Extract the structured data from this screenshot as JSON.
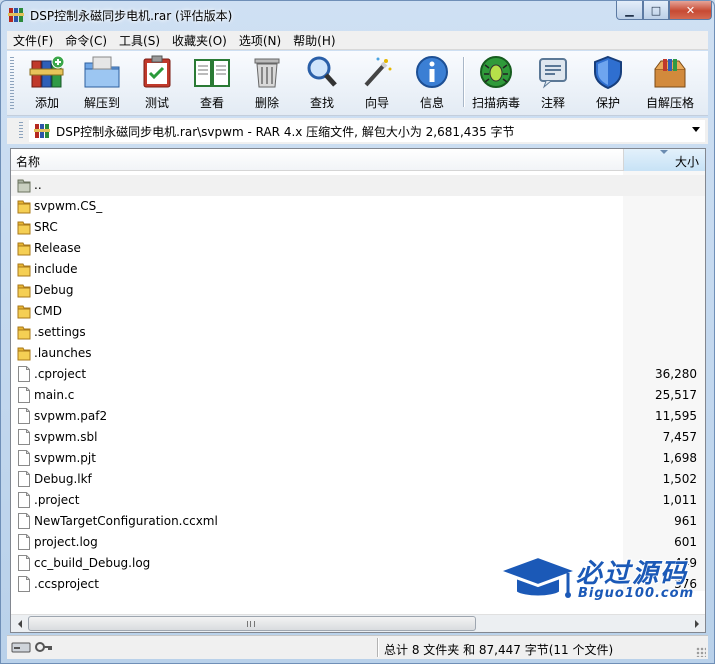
{
  "window": {
    "title": "DSP控制永磁同步电机.rar (评估版本)",
    "minimize_glyph": "▁",
    "maximize_glyph": "□",
    "close_glyph": "✕"
  },
  "menu": [
    "文件(F)",
    "命令(C)",
    "工具(S)",
    "收藏夹(O)",
    "选项(N)",
    "帮助(H)"
  ],
  "toolbar": {
    "add": "添加",
    "extract_to": "解压到",
    "test": "测试",
    "view": "查看",
    "delete": "删除",
    "find": "查找",
    "wizard": "向导",
    "info": "信息",
    "virus_scan": "扫描病毒",
    "comment": "注释",
    "protect": "保护",
    "sfx": "自解压格"
  },
  "address": {
    "text": "DSP控制永磁同步电机.rar\\svpwm - RAR 4.x 压缩文件, 解包大小为 2,681,435 字节"
  },
  "columns": {
    "name": "名称",
    "size": "大小"
  },
  "files": [
    {
      "name": "..",
      "size": "",
      "type": "parent"
    },
    {
      "name": "svpwm.CS_",
      "size": "",
      "type": "folder"
    },
    {
      "name": "SRC",
      "size": "",
      "type": "folder"
    },
    {
      "name": "Release",
      "size": "",
      "type": "folder"
    },
    {
      "name": "include",
      "size": "",
      "type": "folder"
    },
    {
      "name": "Debug",
      "size": "",
      "type": "folder"
    },
    {
      "name": "CMD",
      "size": "",
      "type": "folder"
    },
    {
      "name": ".settings",
      "size": "",
      "type": "folder"
    },
    {
      "name": ".launches",
      "size": "",
      "type": "folder"
    },
    {
      "name": ".cproject",
      "size": "36,280",
      "type": "file"
    },
    {
      "name": "main.c",
      "size": "25,517",
      "type": "file"
    },
    {
      "name": "svpwm.paf2",
      "size": "11,595",
      "type": "file"
    },
    {
      "name": "svpwm.sbl",
      "size": "7,457",
      "type": "file"
    },
    {
      "name": "svpwm.pjt",
      "size": "1,698",
      "type": "file"
    },
    {
      "name": "Debug.lkf",
      "size": "1,502",
      "type": "file"
    },
    {
      "name": ".project",
      "size": "1,011",
      "type": "file"
    },
    {
      "name": "NewTargetConfiguration.ccxml",
      "size": "961",
      "type": "file"
    },
    {
      "name": "project.log",
      "size": "601",
      "type": "file"
    },
    {
      "name": "cc_build_Debug.log",
      "size": "449",
      "type": "file"
    },
    {
      "name": ".ccsproject",
      "size": "376",
      "type": "file"
    }
  ],
  "status": {
    "text": "总计 8 文件夹 和 87,447 字节(11 个文件)"
  },
  "watermark": {
    "title": "必过源码",
    "subtitle": "Biguo100.com"
  },
  "colors": {
    "folder": "#f2c13a",
    "accent_blue": "#1b59b7",
    "frame": "#b9d1ea"
  }
}
